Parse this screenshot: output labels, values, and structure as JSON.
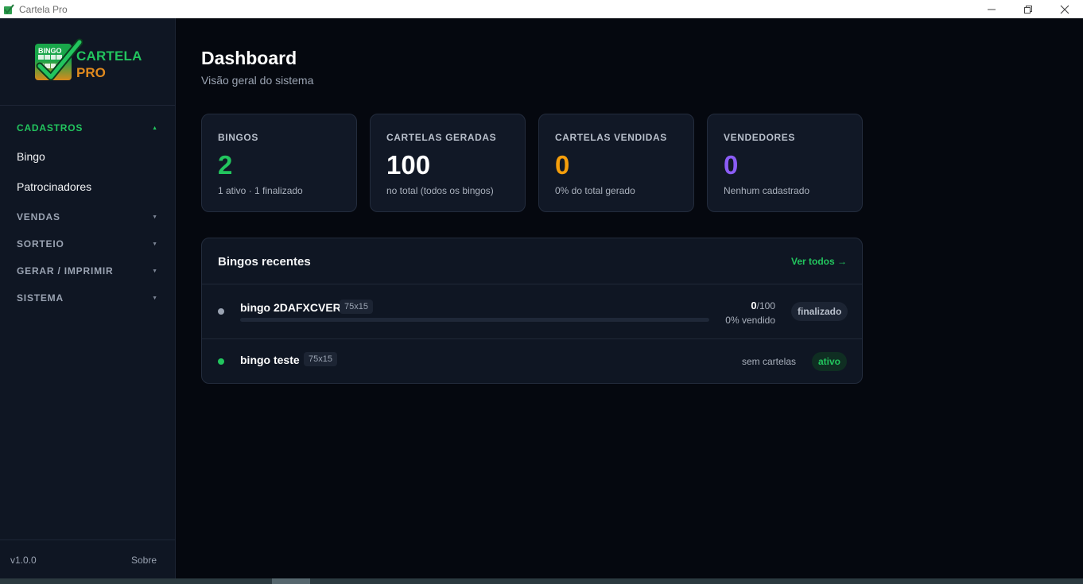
{
  "window": {
    "title": "Cartela Pro",
    "app_icon": "bingo-card-icon",
    "controls": {
      "minimize": "—",
      "maximize": "❐",
      "close": "✕"
    }
  },
  "sidebar": {
    "logo": {
      "bingo": "BINGO",
      "cartela": "CARTELA",
      "pro": "PRO"
    },
    "sections": [
      {
        "label": "CADASTROS",
        "expanded": true,
        "chevron": "▲",
        "items": [
          "Bingo",
          "Patrocinadores"
        ]
      },
      {
        "label": "VENDAS",
        "expanded": false,
        "chevron": "▼"
      },
      {
        "label": "SORTEIO",
        "expanded": false,
        "chevron": "▼"
      },
      {
        "label": "GERAR / IMPRIMIR",
        "expanded": false,
        "chevron": "▼"
      },
      {
        "label": "SISTEMA",
        "expanded": false,
        "chevron": "▼"
      }
    ],
    "version": "v1.0.0",
    "about": "Sobre"
  },
  "header": {
    "title": "Dashboard",
    "subtitle": "Visão geral do sistema"
  },
  "stats": [
    {
      "label": "BINGOS",
      "value": "2",
      "desc": "1 ativo · 1 finalizado",
      "color": "#22c55e"
    },
    {
      "label": "CARTELAS GERADAS",
      "value": "100",
      "desc": "no total (todos os bingos)",
      "color": "#ffffff"
    },
    {
      "label": "CARTELAS VENDIDAS",
      "value": "0",
      "desc": "0% do total gerado",
      "color": "#f59e0b"
    },
    {
      "label": "VENDEDORES",
      "value": "0",
      "desc": "Nenhum cadastrado",
      "color": "#8b5cf6"
    }
  ],
  "recent": {
    "title": "Bingos recentes",
    "see_all": "Ver todos →",
    "items": [
      {
        "name": "bingo 2DAFXCVER",
        "dims": "75x15",
        "sold": "0",
        "total": "/100",
        "percent": "0% vendido",
        "progress": 0,
        "status": "finalizado",
        "dot_color": "#9aa3b2"
      },
      {
        "name": "bingo teste",
        "dims": "75x15",
        "no_cards": "sem cartelas",
        "status": "ativo",
        "dot_color": "#22c55e"
      }
    ]
  }
}
